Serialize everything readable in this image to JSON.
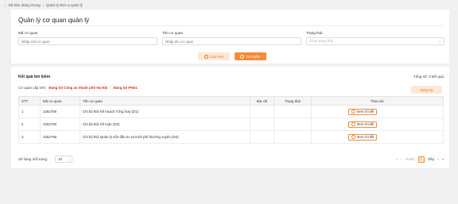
{
  "breadcrumb": {
    "back_icon": "chevron-left-icon",
    "items": [
      "Dữ liệu dùng chung",
      "Quản lý đơn vị quản lý"
    ],
    "separator": "/"
  },
  "filter": {
    "title": "Quản lý cơ quan quản lý",
    "fields": {
      "code": {
        "label": "Mã cơ quan",
        "placeholder": "Nhập mã cơ quan"
      },
      "name": {
        "label": "Tên cơ quan",
        "placeholder": "Nhập tên cơ quan"
      },
      "status": {
        "label": "Trạng thái",
        "placeholder": "Chọn trạng thái"
      }
    },
    "reset_label": "Làm mới",
    "search_label": "Tìm kiếm"
  },
  "results": {
    "title": "Kết quả tìm kiếm",
    "total_prefix": "Tổng số:",
    "total_value": "3",
    "total_suffix": "kết quả",
    "parent_label": "Cơ quan cấp trên:",
    "parent_path": [
      "Đảng bộ Công an thành phố Hà Nội",
      "Đảng bộ PHD1"
    ],
    "back_label": "Quay lại",
    "columns": [
      "STT",
      "Mã cơ quan",
      "Tên cơ quan",
      "Địa chỉ",
      "Trạng thái",
      "Thao tác"
    ],
    "rows": [
      {
        "stt": "1",
        "code": "2262759",
        "name": "Chi bộ Đội Kế hoạch Tổng hợp (D1)",
        "address": "",
        "status": "",
        "action": "Xem chi tiết"
      },
      {
        "stt": "2",
        "code": "2262760",
        "name": "Chi bộ Đội Kế toán (D2)",
        "address": "",
        "status": "",
        "action": "Xem chi tiết"
      },
      {
        "stt": "3",
        "code": "2262758",
        "name": "Chi bộ Đội Quản lý vốn đầu tư và Kinh phí thường xuyên (D3)",
        "address": "",
        "status": "",
        "action": "Xem chi tiết"
      }
    ]
  },
  "pagination": {
    "page_size_label": "Số hàng mỗi trang:",
    "page_size": "10",
    "first_icon": "double-chevron-left-icon",
    "prev_label": "Trước",
    "current_page": "1",
    "next_label": "Tiếp",
    "last_icon": "double-chevron-right-icon"
  },
  "colors": {
    "accent": "#f28c38",
    "accent_light": "#fde8d6",
    "danger": "#d0341c"
  }
}
